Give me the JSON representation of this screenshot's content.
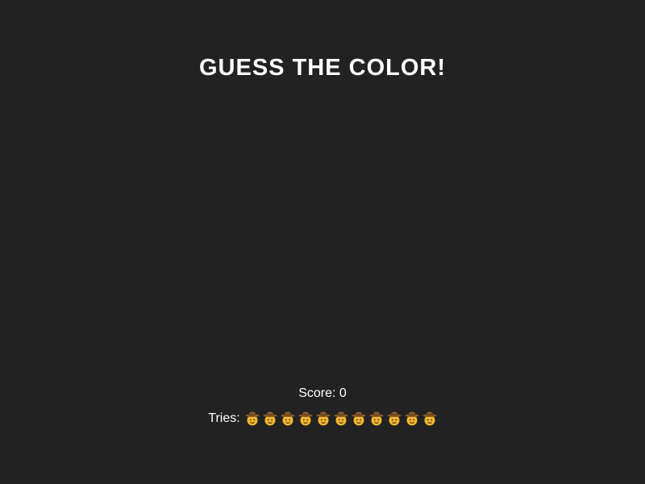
{
  "game": {
    "title": "GUESS THE COLOR!",
    "score_label": "Score:",
    "score_value": "0",
    "tries_label": "Tries:",
    "tries_remaining": 11,
    "tries_icon": "cowboy-face-icon"
  },
  "colors": {
    "background": "#222222",
    "text": "#ffffff",
    "hat": "#8b5a2b",
    "hat_band": "#5c3a18",
    "face": "#f2b632"
  }
}
